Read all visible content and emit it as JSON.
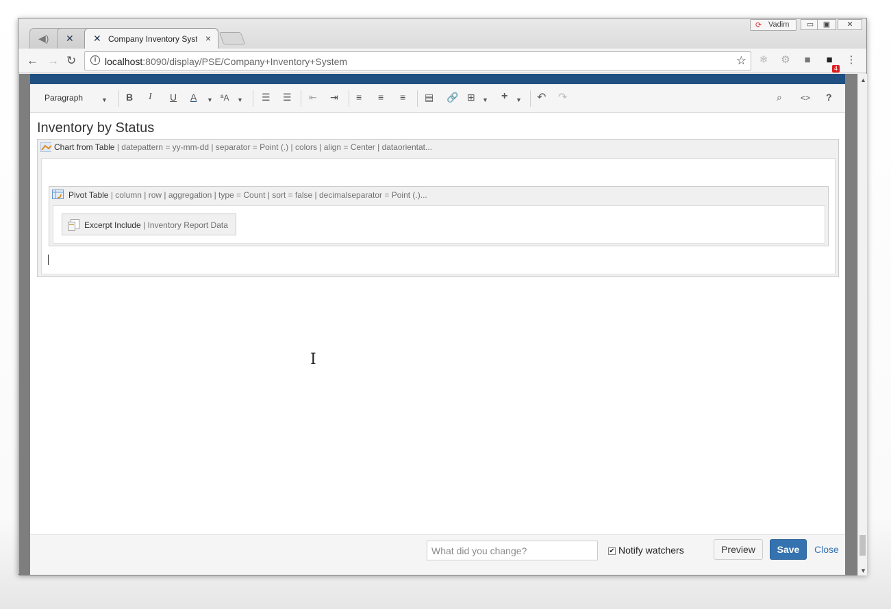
{
  "browser": {
    "tabs": [
      {
        "label": "",
        "icon": "speaker-icon"
      },
      {
        "label": "",
        "icon": "confluence-icon"
      },
      {
        "label": "Company Inventory Systen",
        "icon": "confluence-icon"
      }
    ],
    "profile_name": "Vadim",
    "url_host": "localhost",
    "url_rest": ":8090/display/PSE/Company+Inventory+System",
    "extension_badge": "4"
  },
  "editor": {
    "paragraph_style": "Paragraph",
    "toolbar_icons": [
      "bold-icon",
      "italic-icon",
      "underline-icon",
      "text-color-icon",
      "text-format-icon",
      "bullet-list-icon",
      "numbered-list-icon",
      "outdent-icon",
      "indent-icon",
      "align-left-icon",
      "align-center-icon",
      "align-right-icon",
      "page-layout-icon",
      "link-icon",
      "table-icon",
      "insert-more-icon",
      "undo-icon",
      "redo-icon",
      "search-icon",
      "source-icon",
      "help-icon"
    ],
    "page_title": "Inventory by Status",
    "chart_macro": {
      "name": "Chart from Table",
      "params": " | datepattern = yy-mm-dd | separator = Point (.) | colors | align = Center | dataorientat..."
    },
    "pivot_macro": {
      "name": "Pivot Table",
      "params": " | column | row | aggregation | type = Count | sort = false | decimalseparator = Point (.)..."
    },
    "excerpt_macro": {
      "name": "Excerpt Include",
      "params": " | Inventory Report Data"
    }
  },
  "savebar": {
    "change_placeholder": "What did you change?",
    "notify_label": "Notify watchers",
    "notify_checked": true,
    "preview_label": "Preview",
    "save_label": "Save",
    "close_label": "Close"
  },
  "colors": {
    "save_button": "#3572b0",
    "confluence_header": "#205081"
  }
}
